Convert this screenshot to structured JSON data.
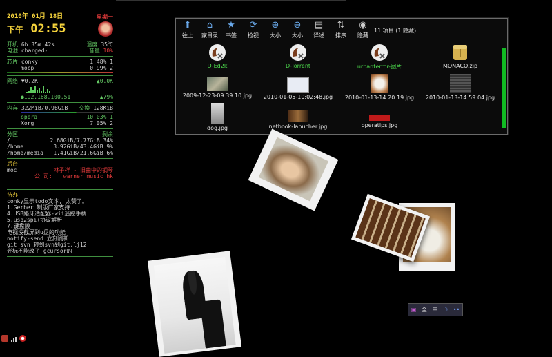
{
  "conky": {
    "date": "2010年 01月 18日",
    "weekday": "星期一",
    "ampm": "下午",
    "time": "02:55",
    "uptime": {
      "label": "开机",
      "value": "6h 35m 42s",
      "temp_label": "温度",
      "temp": "35℃"
    },
    "battery": {
      "label": "电池",
      "value": "charged-",
      "vol_label": "音量",
      "vol": "10%"
    },
    "cpu": {
      "label": "芯片",
      "procs": [
        {
          "name": "conky",
          "pct": "1.48%",
          "n": "1"
        },
        {
          "name": "mocp",
          "pct": "0.99%",
          "n": "2"
        }
      ]
    },
    "net": {
      "label": "网络",
      "down": "▼0.2K",
      "up": "▲0.0K",
      "ip": "●192.168.100.51",
      "sig": "▲79%"
    },
    "mem": {
      "label": "内存",
      "value": "322MiB/0.98GiB",
      "swap_label": "交换",
      "swap": "128KiB",
      "procs": [
        {
          "name": "opera",
          "pct": "10.03%",
          "n": "1"
        },
        {
          "name": "Xorg",
          "pct": "7.05%",
          "n": "2"
        }
      ]
    },
    "disk": {
      "label": "分区",
      "free_label": "剩余",
      "rows": [
        {
          "mount": "/",
          "usage": "2.68GiB/7.77GiB 34%"
        },
        {
          "mount": "/home",
          "usage": "3.92GiB/43.4GiB 9%"
        },
        {
          "mount": "/home/media",
          "usage": "1.41GiB/21.6GiB 6%"
        }
      ]
    },
    "bg": {
      "label": "后台",
      "player": "moc",
      "song": "林子祥 - 旧曲中的钢琴",
      "company_label": "公  司:",
      "company": "warner music hk"
    },
    "todo": {
      "label": "待办",
      "lines": [
        "conky显示todo文本, 太赞了。",
        "1.Gerber 制版厂家支持",
        "4.USB路牙适配器-wii遥控手柄",
        "5.usb2spi+协议解析",
        "7.键盘膜",
        "电视没截屏到u盘的功能",
        "notify-send 立刻刷新",
        "git svn 转到svn到git.lj12",
        "光标不能改了 gcursor的"
      ]
    }
  },
  "filemanager": {
    "toolbar": [
      {
        "label": "往上",
        "icon": "up-arrow-icon",
        "glyph": "⬆"
      },
      {
        "label": "家目录",
        "icon": "home-icon",
        "glyph": "⌂"
      },
      {
        "label": "书签",
        "icon": "bookmark-icon",
        "glyph": "★"
      },
      {
        "label": "检视",
        "icon": "refresh-icon",
        "glyph": "⟳"
      },
      {
        "label": "大小",
        "icon": "zoom-in-icon",
        "glyph": "⊕"
      },
      {
        "label": "大小",
        "icon": "zoom-out-icon",
        "glyph": "⊖"
      },
      {
        "label": "详述",
        "icon": "details-icon",
        "glyph": "▤"
      },
      {
        "label": "排序",
        "icon": "sort-icon",
        "glyph": "⇅"
      },
      {
        "label": "隐藏",
        "icon": "eye-icon",
        "glyph": "◉"
      }
    ],
    "count": "11 项目 (1 隐藏)",
    "items": [
      {
        "name": "D-Ed2k",
        "kind": "folder-link",
        "color": "#4ddc4d"
      },
      {
        "name": "D-Torrent",
        "kind": "folder-link",
        "color": "#4ddc4d"
      },
      {
        "name": "urbanterror-图片",
        "kind": "folder-link",
        "color": "#4ddc4d"
      },
      {
        "name": "MONACO.zip",
        "kind": "zip",
        "color": "#e6e6e6"
      },
      {
        "name": "2009-12-23-09:39:10.jpg",
        "kind": "img",
        "color": "#e6e6e6"
      },
      {
        "name": "2010-01-05-10:02:48.jpg",
        "kind": "img",
        "color": "#e6e6e6"
      },
      {
        "name": "2010-01-13-14:20:19.jpg",
        "kind": "img",
        "color": "#e6e6e6"
      },
      {
        "name": "2010-01-13-14:59:04.jpg",
        "kind": "img",
        "color": "#e6e6e6"
      },
      {
        "name": "dog.jpg",
        "kind": "img",
        "color": "#e6e6e6"
      },
      {
        "name": "netbook-lanucher.jpg",
        "kind": "img",
        "color": "#e6e6e6"
      },
      {
        "name": "operatips.jpg",
        "kind": "img",
        "color": "#e6e6e6"
      }
    ]
  },
  "tray": {
    "items": [
      "全",
      "中",
      "☽",
      "••"
    ]
  },
  "colors": {
    "green": "#64c864",
    "yellow": "#f4d23c",
    "red": "#e23a3a",
    "scroll": "#11bb22"
  }
}
